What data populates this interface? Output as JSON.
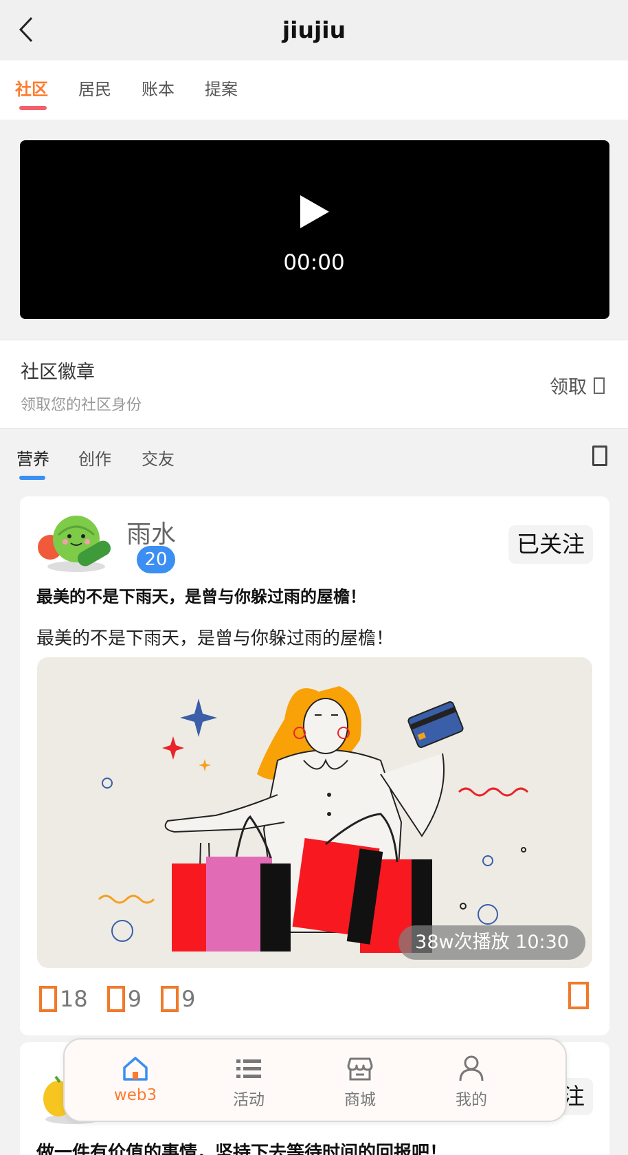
{
  "header": {
    "title": "jiujiu",
    "back_icon": "chevron-left-icon"
  },
  "top_tabs": [
    {
      "label": "社区",
      "active": true
    },
    {
      "label": "居民",
      "active": false
    },
    {
      "label": "账本",
      "active": false
    },
    {
      "label": "提案",
      "active": false
    }
  ],
  "video": {
    "time": "00:00",
    "play_icon": "play-icon"
  },
  "badge": {
    "title": "社区徽章",
    "subtitle": "领取您的社区身份",
    "claim_label": "领取"
  },
  "sub_tabs": [
    {
      "label": "营养",
      "active": true
    },
    {
      "label": "创作",
      "active": false
    },
    {
      "label": "交友",
      "active": false
    }
  ],
  "posts": [
    {
      "user_name": "雨水",
      "level": "20",
      "follow_label": "已关注",
      "title": "最美的不是下雨天，是曾与你躲过雨的屋檐！",
      "text": "最美的不是下雨天，是曾与你躲过雨的屋檐！",
      "play_info": "38w次播放 10:30",
      "likes": "18",
      "comments": "9",
      "collects": "9"
    },
    {
      "follow_label": "注",
      "title": "做一件有价值的事情，坚持下去等待时间的回报吧！"
    }
  ],
  "bottom_nav": [
    {
      "label": "web3",
      "icon": "home-icon",
      "active": true
    },
    {
      "label": "活动",
      "icon": "list-icon",
      "active": false
    },
    {
      "label": "商城",
      "icon": "store-icon",
      "active": false
    },
    {
      "label": "我的",
      "icon": "user-icon",
      "active": false
    }
  ],
  "colors": {
    "accent": "#ff7a2e",
    "tab_indicator": "#f2616b",
    "blue": "#3b8ef2"
  }
}
